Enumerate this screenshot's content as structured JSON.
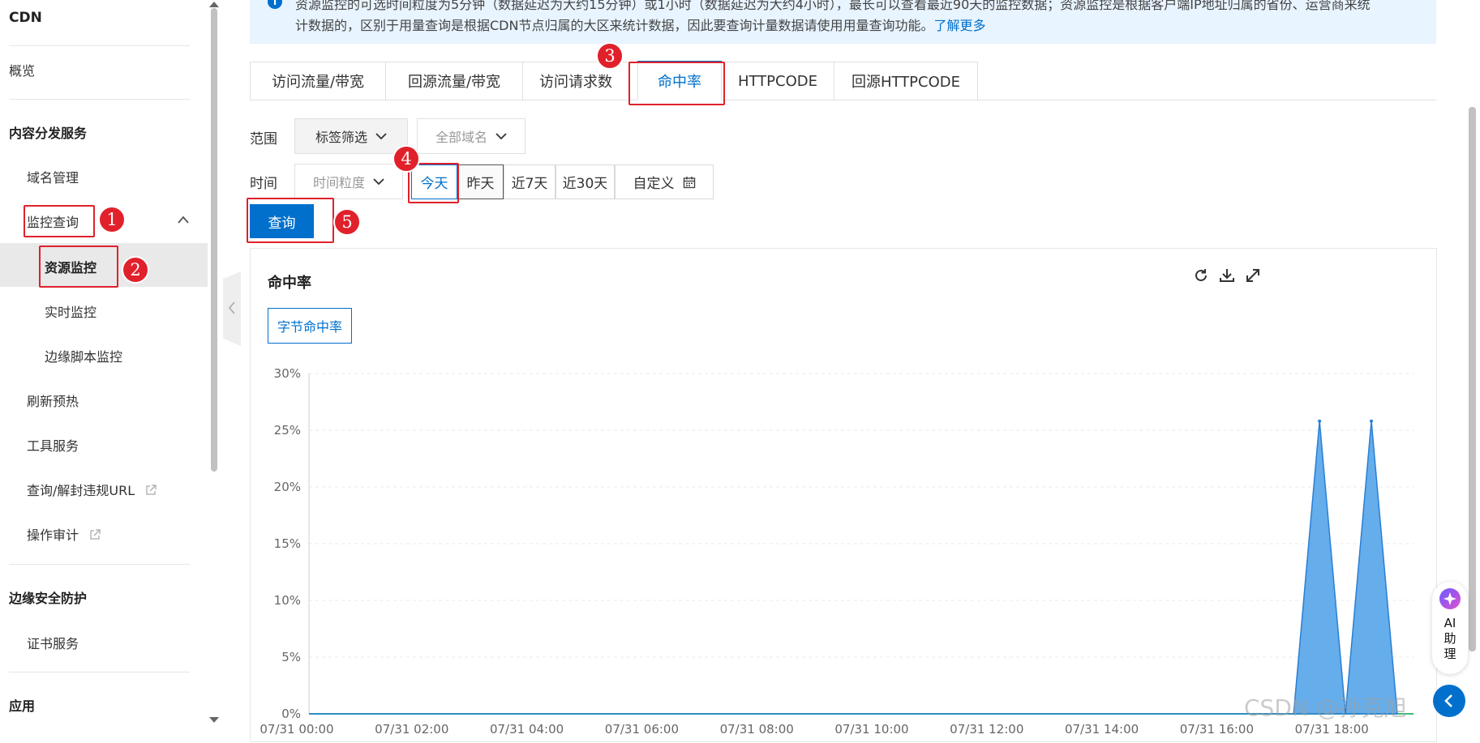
{
  "sidebar": {
    "title": "CDN",
    "overview": "概览",
    "group_cdn": "内容分发服务",
    "domain_mgmt": "域名管理",
    "monitor_query": "监控查询",
    "resource_monitor": "资源监控",
    "realtime_monitor": "实时监控",
    "edge_script_monitor": "边缘脚本监控",
    "refresh_preheat": "刷新预热",
    "tool_service": "工具服务",
    "illegal_url": "查询/解封违规URL",
    "operation_audit": "操作审计",
    "group_security": "边缘安全防护",
    "cert_service": "证书服务",
    "group_app": "应用"
  },
  "banner": {
    "line1": "资源监控的可选时间粒度为5分钟（数据延迟为大约15分钟）或1小时（数据延迟为大约4小时），最长可以查看最近90天的监控数据；资源监控是根据客户端IP地址归属的省份、运营商来统",
    "line2": "计数据的，区别于用量查询是根据CDN节点归属的大区来统计数据，因此要查询计量数据请使用用量查询功能。",
    "learn_more": "了解更多"
  },
  "tabs": [
    {
      "label": "访问流量/带宽"
    },
    {
      "label": "回源流量/带宽"
    },
    {
      "label": "访问请求数"
    },
    {
      "label": "命中率"
    },
    {
      "label": "HTTPCODE"
    },
    {
      "label": "回源HTTPCODE"
    }
  ],
  "filters": {
    "scope_label": "范围",
    "tag_filter": "标签筛选",
    "all_domains": "全部域名",
    "time_label": "时间",
    "granularity_placeholder": "时间粒度",
    "ranges": [
      "今天",
      "昨天",
      "近7天",
      "近30天"
    ],
    "custom": "自定义",
    "query_button": "查询"
  },
  "chart_card": {
    "title": "命中率",
    "metric_tag": "字节命中率"
  },
  "chart_data": {
    "type": "area",
    "title": "命中率",
    "series": [
      {
        "name": "",
        "values": [
          0,
          0,
          0,
          0,
          0,
          0,
          0,
          0,
          0,
          0,
          0,
          0,
          0,
          0,
          0,
          0,
          0,
          0,
          0,
          0,
          0,
          0,
          0,
          0,
          0,
          0,
          0,
          0,
          0,
          0,
          0,
          0,
          0,
          0,
          0,
          0,
          0,
          0,
          0,
          25.8,
          0,
          25.8,
          0
        ]
      }
    ],
    "x_ticks": [
      "07/31 00:00",
      "07/31 02:00",
      "07/31 04:00",
      "07/31 06:00",
      "07/31 08:00",
      "07/31 10:00",
      "07/31 12:00",
      "07/31 14:00",
      "07/31 16:00",
      "07/31 18:00"
    ],
    "y_ticks": [
      "0%",
      "5%",
      "10%",
      "15%",
      "20%",
      "25%",
      "30%"
    ],
    "ylim": [
      0,
      30
    ],
    "grid": true,
    "colors": {
      "area": "#4a9fe8",
      "line": "#2a7fd4",
      "baseline": "#3dbb7a"
    }
  },
  "annotations": [
    "1",
    "2",
    "3",
    "4",
    "5"
  ],
  "ai_assistant": {
    "label_lines": [
      "AI",
      "助",
      "理"
    ]
  },
  "watermark": "CSDN @孙克旭",
  "colors": {
    "accent": "#0070cc",
    "annotation": "#e0212b"
  }
}
